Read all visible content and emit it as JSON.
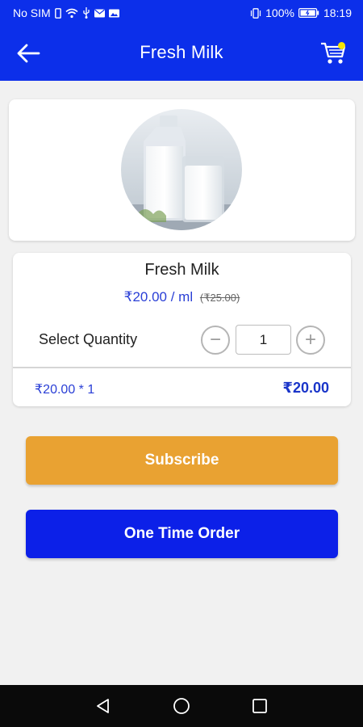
{
  "status_bar": {
    "carrier": "No SIM",
    "battery": "100%",
    "time": "18:19"
  },
  "app_bar": {
    "title": "Fresh Milk",
    "back_icon": "arrow-left-icon",
    "cart_icon": "cart-icon"
  },
  "product": {
    "name": "Fresh Milk",
    "price": "₹20.00 / ml",
    "old_price": "(₹25.00)",
    "image_alt": "milk-bottle-and-glass"
  },
  "quantity": {
    "label": "Select Quantity",
    "value": "1",
    "minus": "−",
    "plus": "+"
  },
  "summary": {
    "calculation": "₹20.00 * 1",
    "total": "₹20.00"
  },
  "actions": {
    "subscribe_label": "Subscribe",
    "one_time_label": "One Time Order"
  },
  "colors": {
    "primary": "#0c2fea",
    "subscribe": "#e9a232",
    "price": "#2a3fd6"
  }
}
